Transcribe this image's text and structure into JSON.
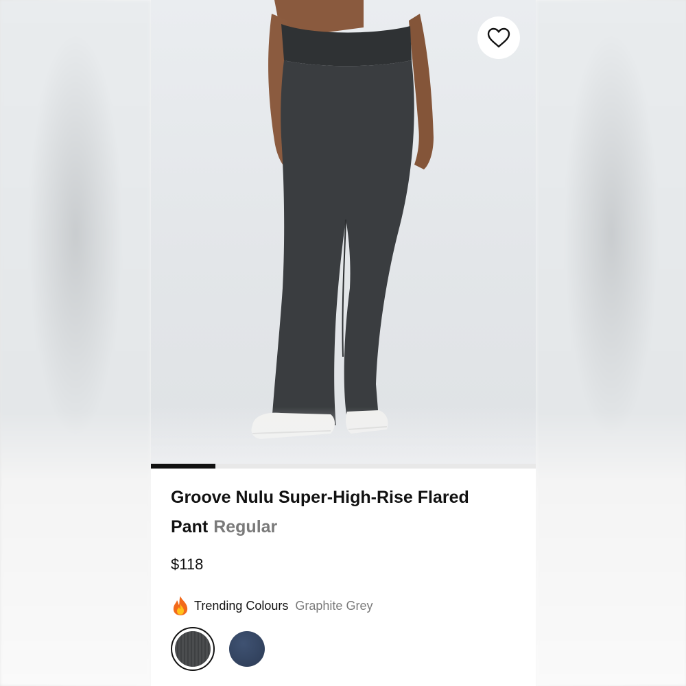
{
  "product": {
    "title": "Groove Nulu Super-High-Rise Flared Pant",
    "fit": "Regular",
    "price": "$118",
    "image_alt": "Model wearing dark grey flared pants with white sneakers"
  },
  "gallery": {
    "progress_fraction": 0.167
  },
  "wishlist": {
    "icon": "heart-icon"
  },
  "colours": {
    "label": "Trending Colours",
    "selected_name": "Graphite Grey",
    "icon": "fire-icon",
    "swatches": [
      {
        "name": "Graphite Grey",
        "color": "#46484a",
        "selected": true
      },
      {
        "name": "navy",
        "color": "#34466a",
        "selected": false
      }
    ]
  },
  "theme": {
    "text": "#111111",
    "muted": "#7a7a7a",
    "background": "#ffffff"
  }
}
